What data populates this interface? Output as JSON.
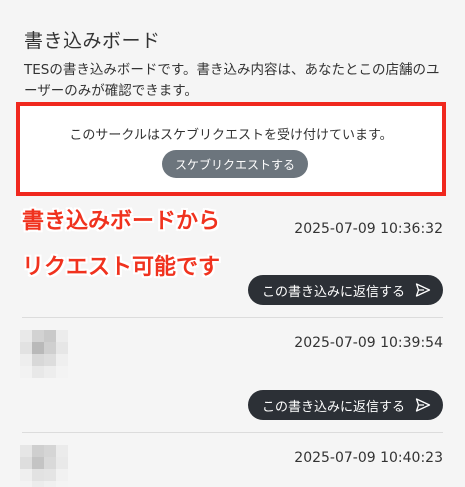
{
  "board": {
    "title": "書き込みボード",
    "description": "TESの書き込みボードです。書き込み内容は、あなたとこの店舗のユーザーのみが確認できます。"
  },
  "sketch_request": {
    "notice": "このサークルはスケブリクエストを受け付けています。",
    "button_label": "スケブリクエストする"
  },
  "annotation": {
    "line1": "書き込みボードから",
    "line2": "リクエスト可能です"
  },
  "posts": [
    {
      "timestamp": "2025-07-09 10:36:32",
      "reply_label": "この書き込みに返信する"
    },
    {
      "timestamp": "2025-07-09 10:39:54",
      "reply_label": "この書き込みに返信する"
    },
    {
      "timestamp": "2025-07-09 10:40:23"
    }
  ],
  "colors": {
    "accent_red": "#f0281e",
    "button_gray": "#6c757d",
    "reply_dark": "#2c3036"
  },
  "icons": {
    "reply": "send-icon",
    "avatar": "pixelated-avatar"
  }
}
